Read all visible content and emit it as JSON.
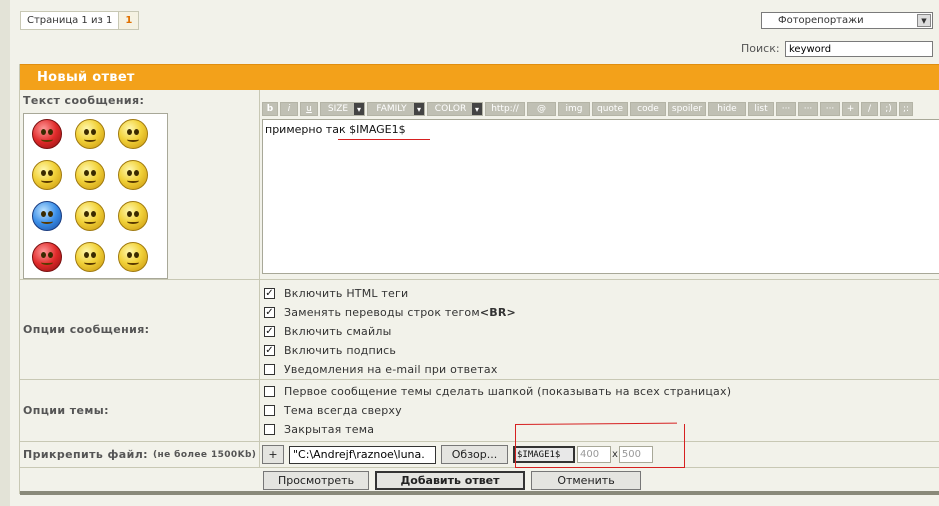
{
  "pagination": {
    "text": "Страница 1 из 1",
    "current": "1"
  },
  "forum_select": {
    "selected": "Фоторепортажи"
  },
  "search": {
    "label": "Поиск:",
    "value": "keyword"
  },
  "reply": {
    "header": "Новый ответ",
    "message_label": "Текст сообщения:",
    "toolbar": [
      "b",
      "i",
      "u",
      "SIZE",
      "FAMILY",
      "COLOR",
      "http://",
      "@",
      "img",
      "quote",
      "code",
      "spoiler",
      "hide",
      "list",
      "···",
      "···",
      "···",
      "+",
      "/",
      ";)",
      ";:"
    ],
    "editor_text": "примерно так $IMAGE1$",
    "smilies": [
      "angry",
      "grin",
      "cool",
      "cry",
      "shocked",
      "smile",
      "cold",
      "biggrin",
      "ohmy",
      "tongue",
      "crazy",
      "laugh"
    ]
  },
  "message_options": {
    "label": "Опции сообщения:",
    "items": [
      {
        "label": "Включить HTML теги",
        "checked": true
      },
      {
        "label_pre": "Заменять переводы строк тегом ",
        "label_tag": "<BR>",
        "checked": true
      },
      {
        "label": "Включить смайлы",
        "checked": true
      },
      {
        "label": "Включить подпись",
        "checked": true
      },
      {
        "label": "Уведомления на e-mail при ответах",
        "checked": false
      }
    ]
  },
  "topic_options": {
    "label": "Опции темы:",
    "items": [
      {
        "label": "Первое сообщение темы сделать шапкой (показывать на всех страницах)",
        "checked": false
      },
      {
        "label": "Тема всегда сверху",
        "checked": false
      },
      {
        "label": "Закрытая тема",
        "checked": false
      }
    ]
  },
  "attach": {
    "label": "Прикрепить файл:",
    "limit": "(не более 1500Kb)",
    "plus": "+",
    "file_value": "\"C:\\Andrejf\\raznoe\\luna.",
    "browse": "Обзор...",
    "tag": "$IMAGE1$",
    "width": "400",
    "times": "x",
    "height": "500"
  },
  "buttons": {
    "preview": "Просмотреть",
    "submit": "Добавить ответ",
    "cancel": "Отменить"
  },
  "colors": {
    "header_bg": "#f3a11a",
    "annotation": "#d62020",
    "page_bg": "#f2f2ea"
  }
}
